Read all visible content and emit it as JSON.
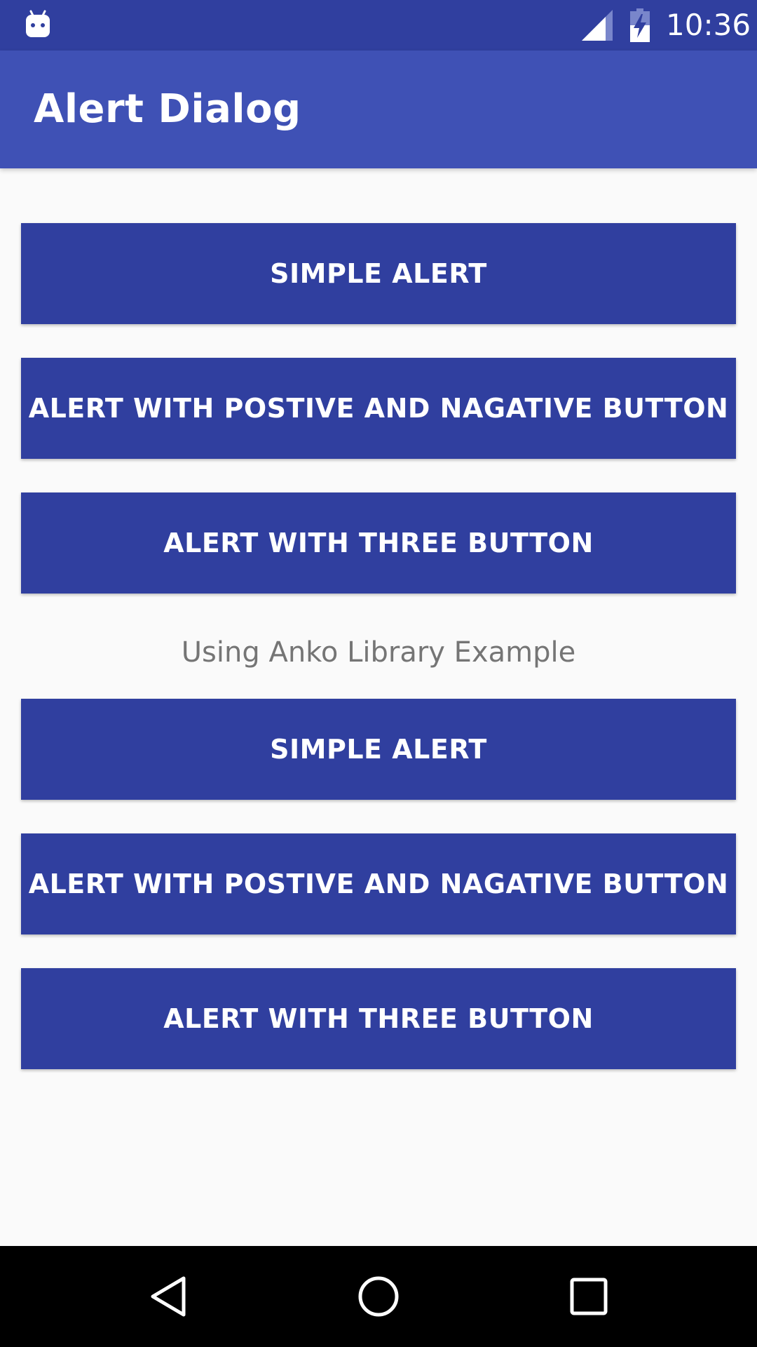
{
  "status_bar": {
    "time": "10:36",
    "icons": [
      "android-notification-icon",
      "signal-icon",
      "battery-charging-icon"
    ]
  },
  "app_bar": {
    "title": "Alert Dialog"
  },
  "buttons": [
    {
      "label": "SIMPLE ALERT"
    },
    {
      "label": "ALERT WITH POSTIVE AND NAGATIVE BUTTON"
    },
    {
      "label": "ALERT WITH THREE BUTTON"
    }
  ],
  "anko_section": {
    "label": "Using Anko Library Example",
    "buttons": [
      {
        "label": "SIMPLE ALERT"
      },
      {
        "label": "ALERT WITH POSTIVE AND NAGATIVE BUTTON"
      },
      {
        "label": "ALERT WITH THREE BUTTON"
      }
    ]
  },
  "nav_bar": {
    "icons": [
      "back-icon",
      "home-icon",
      "recents-icon"
    ]
  },
  "colors": {
    "status_bar": "#303f9f",
    "app_bar": "#3f51b5",
    "button": "#303f9f",
    "background": "#fafafa",
    "section_text": "#757575"
  }
}
